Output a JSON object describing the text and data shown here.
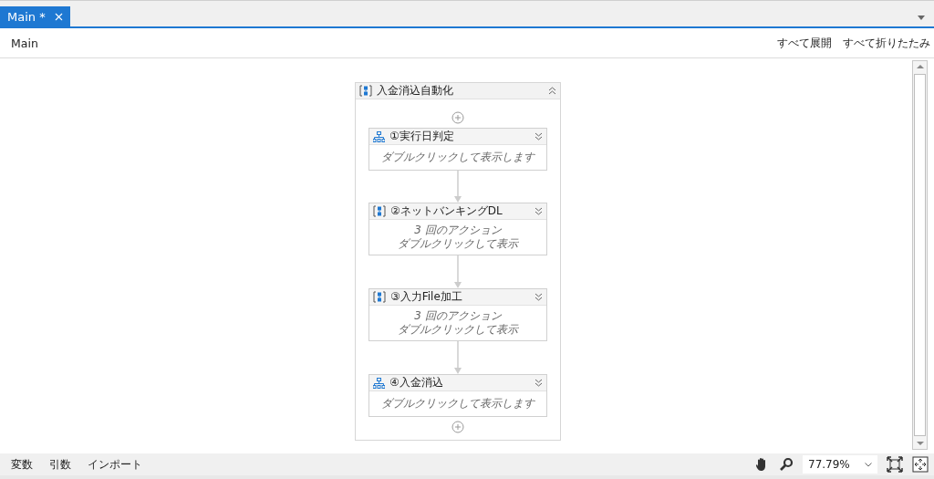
{
  "tabs": [
    {
      "label": "Main *",
      "selected": true
    }
  ],
  "breadcrumb": "Main",
  "header_links": [
    "すべて展開",
    "すべて折りたたみ"
  ],
  "sequence": {
    "title": "入金消込自動化",
    "expanded": true,
    "activities": [
      {
        "kind": "flowchart",
        "title": "①実行日判定",
        "expanded": false,
        "lines": [
          "ダブルクリックして表示します"
        ]
      },
      {
        "kind": "sequence",
        "title": "②ネットバンキングDL",
        "expanded": false,
        "lines": [
          "3 回のアクション",
          "ダブルクリックして表示"
        ]
      },
      {
        "kind": "sequence",
        "title": "③入力File加工",
        "expanded": false,
        "lines": [
          "3 回のアクション",
          "ダブルクリックして表示"
        ]
      },
      {
        "kind": "flowchart",
        "title": "④入金消込",
        "expanded": false,
        "lines": [
          "ダブルクリックして表示します"
        ]
      }
    ]
  },
  "status_bar": {
    "tabs": [
      "変数",
      "引数",
      "インポート"
    ],
    "zoom": "77.79%"
  }
}
